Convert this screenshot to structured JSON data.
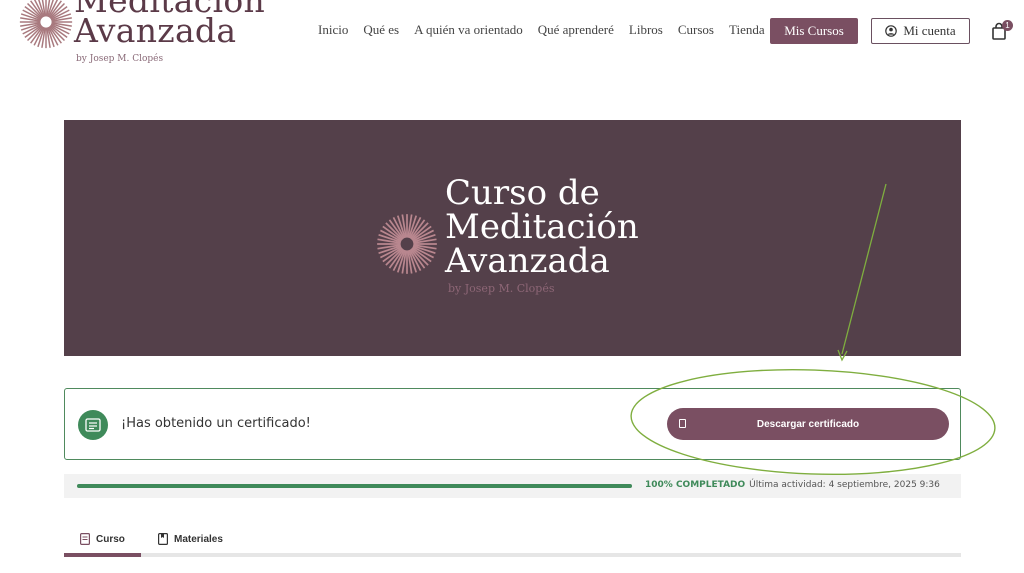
{
  "header": {
    "logo": {
      "title_line1": "Meditación",
      "title_line2": "Avanzada",
      "subtitle": "by Josep M. Clopés"
    },
    "nav": [
      "Inicio",
      "Qué es",
      "A quién va orientado",
      "Qué aprenderé",
      "Libros",
      "Cursos",
      "Tienda"
    ],
    "mis_cursos_label": "Mis Cursos",
    "mi_cuenta_label": "Mi cuenta",
    "cart_count": "1"
  },
  "banner": {
    "line1": "Curso de",
    "line2": "Meditación",
    "line3": "Avanzada",
    "subtitle": "by Josep M. Clopés"
  },
  "certificate": {
    "message": "¡Has obtenido un certificado!",
    "button_label": "Descargar certificado"
  },
  "progress": {
    "percent": 100,
    "percent_label": "100% COMPLETADO",
    "last_activity": "Última actividad: 4 septiembre, 2025 9:36"
  },
  "tabs": [
    {
      "label": "Curso",
      "active": true
    },
    {
      "label": "Materiales",
      "active": false
    }
  ],
  "colors": {
    "brand": "#7a4f62",
    "banner_bg": "#54404a",
    "success": "#3f8a5a",
    "annotation": "#7fae3f"
  },
  "icons": {
    "logo": "sunburst-logo-icon",
    "account": "user-circle-icon",
    "cart": "shopping-bag-icon",
    "certificate": "certificate-icon",
    "download": "document-icon",
    "tab_curso": "book-icon",
    "tab_materiales": "bookmark-icon"
  }
}
